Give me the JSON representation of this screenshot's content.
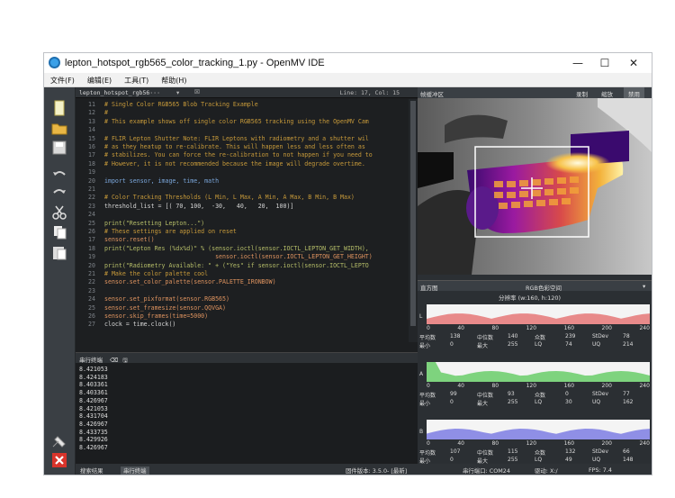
{
  "window": {
    "title": "lepton_hotspot_rgb565_color_tracking_1.py - OpenMV IDE",
    "controls": [
      "—",
      "☐",
      "✕"
    ]
  },
  "menu": [
    "文件(F)",
    "编辑(E)",
    "工具(T)",
    "帮助(H)"
  ],
  "editor": {
    "tab": "lepton_hotspot_rgb56···",
    "cursor": "Line: 17, Col: 15",
    "lines": [
      {
        "n": "11",
        "t": "# Single Color RGB565 Blob Tracking Example",
        "c": "#c79a3a"
      },
      {
        "n": "12",
        "t": "#",
        "c": "#c79a3a"
      },
      {
        "n": "13",
        "t": "# This example shows off single color RGB565 tracking using the OpenMV Cam",
        "c": "#c79a3a"
      },
      {
        "n": "14",
        "t": "",
        "c": "#ddd"
      },
      {
        "n": "15",
        "t": "# FLIR Lepton Shutter Note: FLIR Leptons with radiometry and a shutter wil",
        "c": "#c79a3a"
      },
      {
        "n": "16",
        "t": "# as they heatup to re-calibrate. This will happen less and less often as",
        "c": "#c79a3a"
      },
      {
        "n": "17",
        "t": "# stabilizes. You can force the re-calibration to not happen if you need to",
        "c": "#c79a3a"
      },
      {
        "n": "18",
        "t": "# However, it is not recommended because the image will degrade overtime.",
        "c": "#c79a3a"
      },
      {
        "n": "19",
        "t": "",
        "c": "#ddd"
      },
      {
        "n": "20",
        "t": "import sensor, image, time, math",
        "c": "#7aa6da"
      },
      {
        "n": "21",
        "t": "",
        "c": "#ddd"
      },
      {
        "n": "22",
        "t": "# Color Tracking Thresholds (L Min, L Max, A Min, A Max, B Min, B Max)",
        "c": "#c79a3a"
      },
      {
        "n": "23",
        "t": "threshold_list = [( 70, 100,  -30,   40,   20,  100)]",
        "c": "#d6d6d6"
      },
      {
        "n": "24",
        "t": "",
        "c": "#ddd"
      },
      {
        "n": "25",
        "t": "print(\"Resetting Lepton...\")",
        "c": "#b5bd68"
      },
      {
        "n": "26",
        "t": "# These settings are applied on reset",
        "c": "#c79a3a"
      },
      {
        "n": "17",
        "t": "sensor.reset()",
        "c": "#de935f"
      },
      {
        "n": "18",
        "t": "print(\"Lepton Res (%dx%d)\" % (sensor.ioctl(sensor.IOCTL_LEPTON_GET_WIDTH),",
        "c": "#b5bd68"
      },
      {
        "n": "19",
        "t": "                               sensor.ioctl(sensor.IOCTL_LEPTON_GET_HEIGHT)",
        "c": "#de935f"
      },
      {
        "n": "20",
        "t": "print(\"Radiometry Available: \" + (\"Yes\" if sensor.ioctl(sensor.IOCTL_LEPTO",
        "c": "#b5bd68"
      },
      {
        "n": "21",
        "t": "# Make the color palette cool",
        "c": "#c79a3a"
      },
      {
        "n": "22",
        "t": "sensor.set_color_palette(sensor.PALETTE_IRONBOW)",
        "c": "#de935f"
      },
      {
        "n": "23",
        "t": "",
        "c": "#ddd"
      },
      {
        "n": "24",
        "t": "sensor.set_pixformat(sensor.RGB565)",
        "c": "#de935f"
      },
      {
        "n": "25",
        "t": "sensor.set_framesize(sensor.QQVGA)",
        "c": "#de935f"
      },
      {
        "n": "26",
        "t": "sensor.skip_frames(time=5000)",
        "c": "#de935f"
      },
      {
        "n": "27",
        "t": "clock = time.clock()",
        "c": "#d6d6d6"
      }
    ]
  },
  "terminal": {
    "title": "串行终端",
    "lines": [
      "8.421053",
      "8.424183",
      "8.403361",
      "8.403361",
      "8.426967",
      "8.421053",
      "8.431704",
      "8.426967",
      "8.433735",
      "8.429926",
      "8.426967"
    ]
  },
  "framebuffer": {
    "title": "帧缓冲区",
    "buttons": [
      "录制",
      "缩放",
      "禁用"
    ]
  },
  "histogram": {
    "title": "直方图",
    "mode": "RGB色彩空间",
    "resolution": "分辨率 (w:160, h:120)",
    "axis": [
      "0",
      "40",
      "80",
      "120",
      "160",
      "200",
      "240"
    ],
    "channels": [
      {
        "key": "L",
        "color": "#e88a8a",
        "stats": [
          [
            "平均数",
            "138"
          ],
          [
            "中位数",
            "140"
          ],
          [
            "众数",
            "239"
          ],
          [
            "StDev",
            "78"
          ]
        ],
        "stats2": [
          [
            "最小",
            "0"
          ],
          [
            "最大",
            "255"
          ],
          [
            "LQ",
            "74"
          ],
          [
            "UQ",
            "214"
          ]
        ]
      },
      {
        "key": "A",
        "color": "#7ed37e",
        "stats": [
          [
            "平均数",
            "99"
          ],
          [
            "中位数",
            "93"
          ],
          [
            "众数",
            "0"
          ],
          [
            "StDev",
            "77"
          ]
        ],
        "stats2": [
          [
            "最小",
            "0"
          ],
          [
            "最大",
            "255"
          ],
          [
            "LQ",
            "30"
          ],
          [
            "UQ",
            "162"
          ]
        ]
      },
      {
        "key": "B",
        "color": "#8f8fe6",
        "stats": [
          [
            "平均数",
            "107"
          ],
          [
            "中位数",
            "115"
          ],
          [
            "众数",
            "132"
          ],
          [
            "StDev",
            "66"
          ]
        ],
        "stats2": [
          [
            "最小",
            "0"
          ],
          [
            "最大",
            "255"
          ],
          [
            "LQ",
            "49"
          ],
          [
            "UQ",
            "148"
          ]
        ]
      }
    ]
  },
  "status": {
    "left1": "搜索结果",
    "left2": "串行终端",
    "fw": "固件版本: 3.5.0- [最新]",
    "port": "串行端口: COM24",
    "drive": "驱动: X:/",
    "fps": "FPS:  7.4"
  }
}
